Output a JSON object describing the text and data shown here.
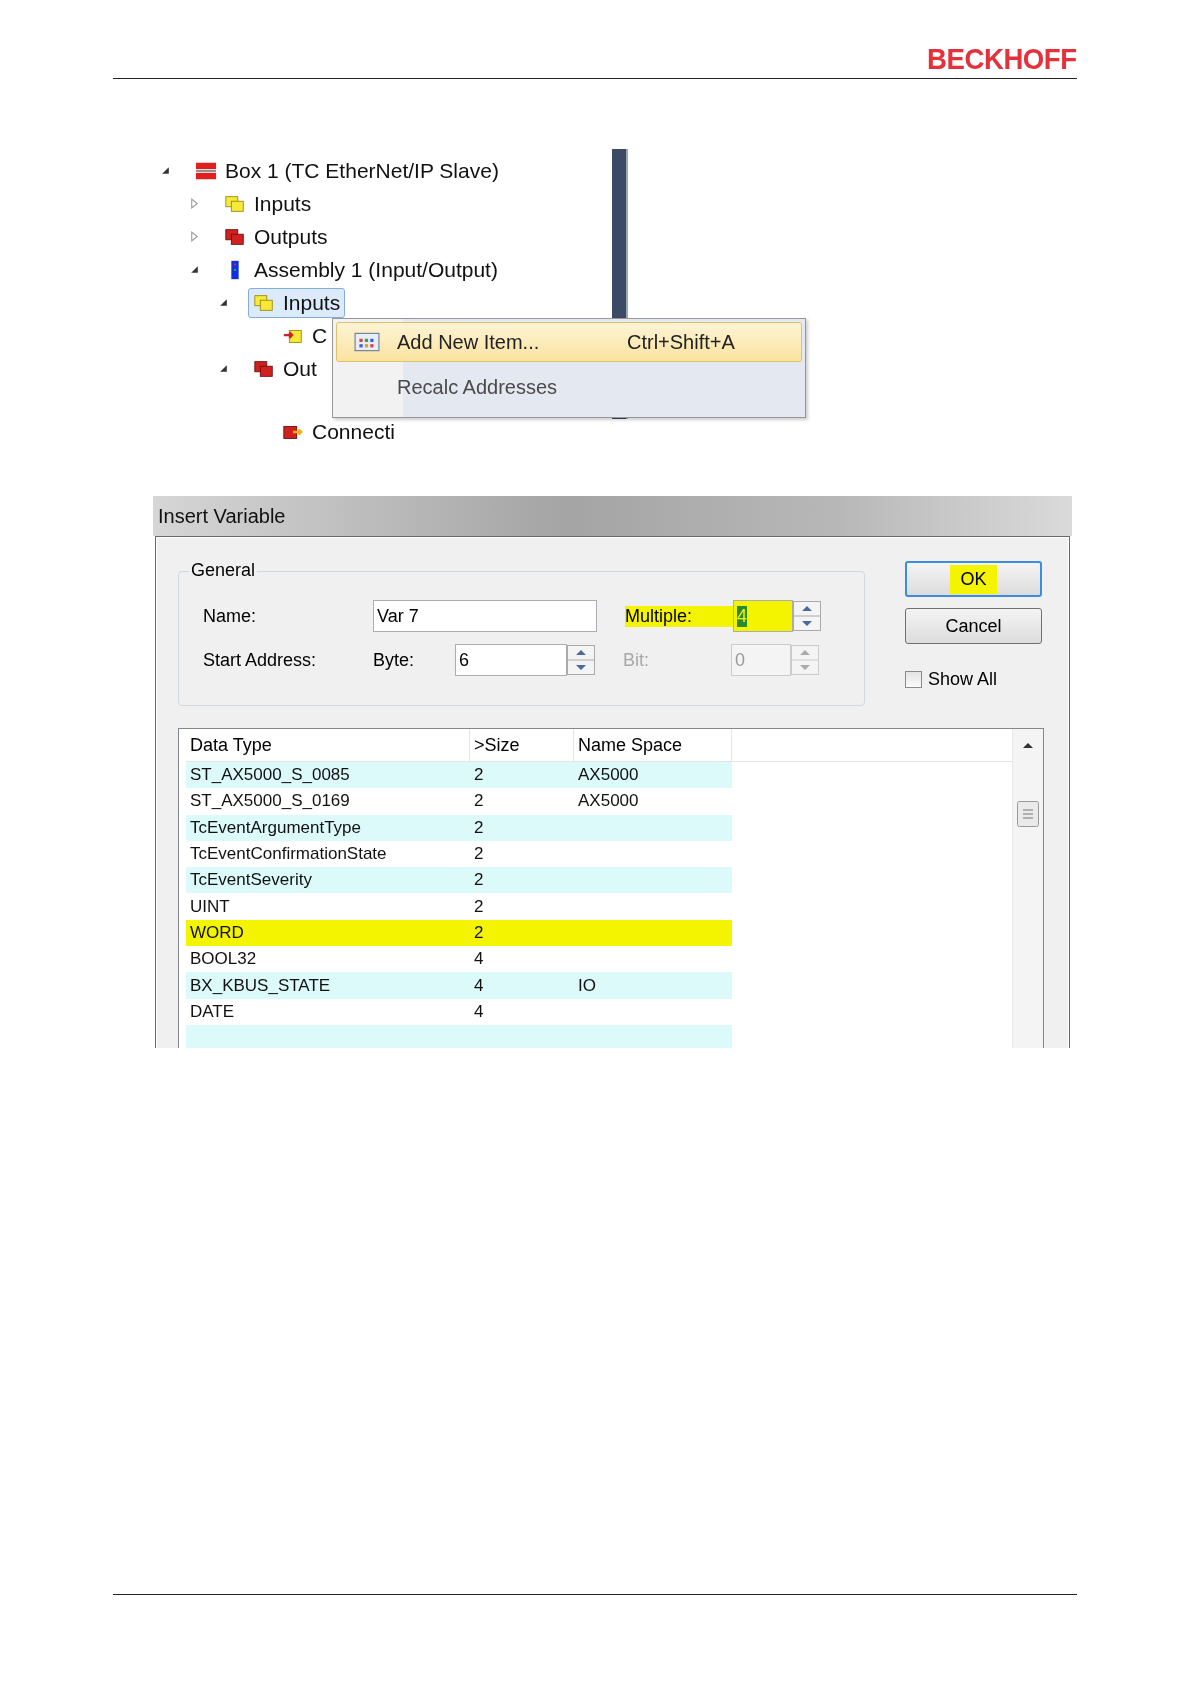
{
  "header": {
    "logo": "BECKHOFF"
  },
  "tree": [
    {
      "label": "Box 1 (TC EtherNet/IP Slave)",
      "kind": "device",
      "expanded": true,
      "selected": false,
      "children": [
        {
          "label": "Inputs",
          "kind": "inputs",
          "expanded": false,
          "selected": false
        },
        {
          "label": "Outputs",
          "kind": "outputs",
          "expanded": false,
          "selected": false
        },
        {
          "label": "Assembly 1 (Input/Output)",
          "kind": "assembly",
          "expanded": true,
          "selected": false,
          "children": [
            {
              "label": "Inputs",
              "kind": "inputs",
              "expanded": true,
              "selected": true,
              "children": [
                {
                  "label": "C",
                  "kind": "input-var",
                  "selected": false
                }
              ]
            },
            {
              "label": "Out",
              "kind": "outputs",
              "expanded": true,
              "selected": false,
              "children": [
                {
                  "label": "Connecti",
                  "kind": "output-var",
                  "selected": false
                }
              ]
            }
          ]
        }
      ]
    }
  ],
  "context_menu": [
    {
      "label": "Add New Item...",
      "shortcut": "Ctrl+Shift+A",
      "icon": true,
      "selected": true
    },
    {
      "label": "Recalc Addresses",
      "selected": false
    }
  ],
  "dialog": {
    "title": "Insert Variable",
    "group": "General",
    "name": {
      "label": "Name:",
      "value": "Var 7"
    },
    "multiple": {
      "label": "Multiple:",
      "value": "4",
      "highlighted": true
    },
    "start_address": {
      "label": "Start Address:",
      "byte_label": "Byte:",
      "byte_value": "6",
      "bit_label": "Bit:",
      "bit_value": "0",
      "bit_disabled": true
    },
    "buttons": [
      {
        "label": "OK",
        "default": true,
        "highlighted": true
      },
      {
        "label": "Cancel",
        "default": false,
        "highlighted": false
      }
    ],
    "show_all": {
      "label": "Show All",
      "checked": false
    },
    "table": {
      "columns": [
        "Data Type",
        ">Size",
        "Name Space"
      ],
      "rows": [
        {
          "cells": [
            "ST_AX5000_S_0085",
            "2",
            "AX5000"
          ],
          "highlighted": false
        },
        {
          "cells": [
            "ST_AX5000_S_0169",
            "2",
            "AX5000"
          ],
          "highlighted": false
        },
        {
          "cells": [
            "TcEventArgumentType",
            "2",
            ""
          ],
          "highlighted": false
        },
        {
          "cells": [
            "TcEventConfirmationState",
            "2",
            ""
          ],
          "highlighted": false
        },
        {
          "cells": [
            "TcEventSeverity",
            "2",
            ""
          ],
          "highlighted": false
        },
        {
          "cells": [
            "UINT",
            "2",
            ""
          ],
          "highlighted": false
        },
        {
          "cells": [
            "WORD",
            "2",
            ""
          ],
          "highlighted": true
        },
        {
          "cells": [
            "BOOL32",
            "4",
            ""
          ],
          "highlighted": false
        },
        {
          "cells": [
            "BX_KBUS_STATE",
            "4",
            "IO"
          ],
          "highlighted": false
        },
        {
          "cells": [
            "DATE",
            "4",
            ""
          ],
          "highlighted": false
        }
      ]
    }
  }
}
